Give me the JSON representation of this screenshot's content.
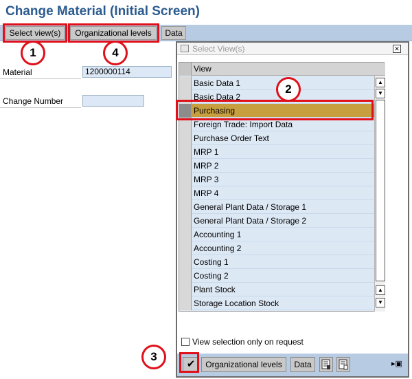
{
  "window": {
    "title": "Change Material (Initial Screen)"
  },
  "toolbar": {
    "select_views_label": "Select view(s)",
    "org_levels_label": "Organizational levels",
    "data_label": "Data"
  },
  "form": {
    "material_label": "Material",
    "material_value": "1200000114",
    "change_number_label": "Change Number",
    "change_number_value": ""
  },
  "dialog": {
    "title": "Select View(s)",
    "close_icon": "close-icon",
    "column_header": "View",
    "views": [
      {
        "label": "Basic Data 1",
        "selected": false
      },
      {
        "label": "Basic Data 2",
        "selected": false
      },
      {
        "label": "Purchasing",
        "selected": true
      },
      {
        "label": "Foreign Trade: Import Data",
        "selected": false
      },
      {
        "label": "Purchase Order Text",
        "selected": false
      },
      {
        "label": "MRP 1",
        "selected": false
      },
      {
        "label": "MRP 2",
        "selected": false
      },
      {
        "label": "MRP 3",
        "selected": false
      },
      {
        "label": "MRP 4",
        "selected": false
      },
      {
        "label": "General Plant Data / Storage 1",
        "selected": false
      },
      {
        "label": "General Plant Data / Storage 2",
        "selected": false
      },
      {
        "label": "Accounting 1",
        "selected": false
      },
      {
        "label": "Accounting 2",
        "selected": false
      },
      {
        "label": "Costing 1",
        "selected": false
      },
      {
        "label": "Costing 2",
        "selected": false
      },
      {
        "label": "Plant Stock",
        "selected": false
      },
      {
        "label": "Storage Location Stock",
        "selected": false
      }
    ],
    "checkbox_label": "View selection only on request",
    "checkbox_checked": false,
    "footer": {
      "confirm_icon": "checkmark-icon",
      "org_levels_label": "Organizational levels",
      "data_label": "Data"
    }
  },
  "annotations": {
    "step_1": "1",
    "step_2": "2",
    "step_3": "3",
    "step_4": "4",
    "color": "#e0101a"
  },
  "colors": {
    "title": "#2b5b8e",
    "toolbar_bg": "#b7cbe3",
    "table_bg": "#dde8f5",
    "selected_row": "#c79f3f"
  }
}
